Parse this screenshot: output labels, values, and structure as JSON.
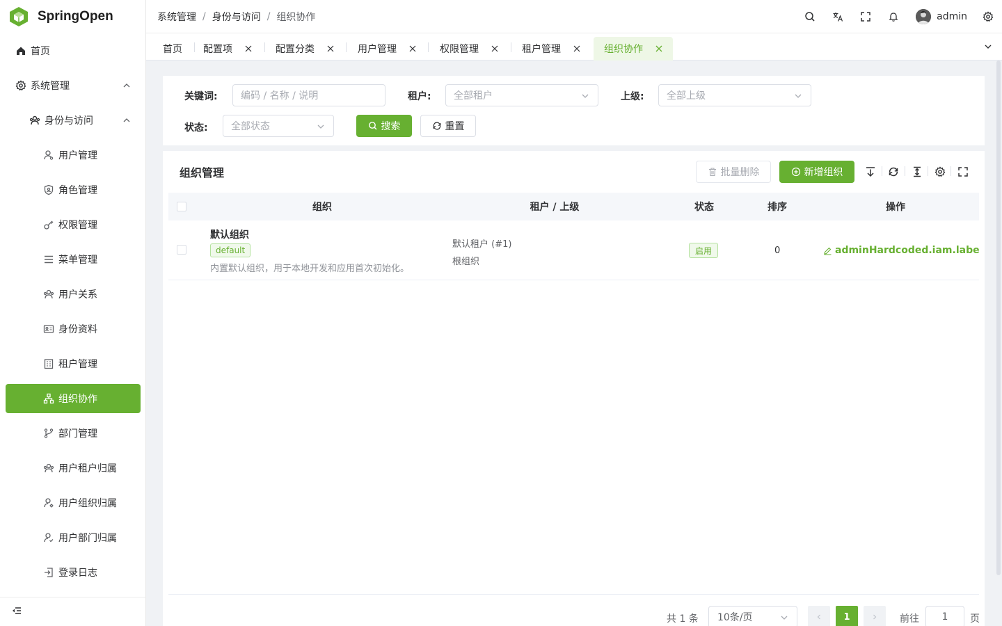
{
  "app": {
    "name": "SpringOpen",
    "accent": "#67b031"
  },
  "sidebar": {
    "items": [
      {
        "label": "首页",
        "icon": "home-icon"
      },
      {
        "label": "系统管理",
        "icon": "gear-icon"
      },
      {
        "label": "身份与访问",
        "icon": "users-icon"
      },
      {
        "label": "用户管理",
        "icon": "user-icon"
      },
      {
        "label": "角色管理",
        "icon": "shield-icon"
      },
      {
        "label": "权限管理",
        "icon": "key-icon"
      },
      {
        "label": "菜单管理",
        "icon": "menu-icon"
      },
      {
        "label": "用户关系",
        "icon": "users-icon"
      },
      {
        "label": "身份资料",
        "icon": "id-card-icon"
      },
      {
        "label": "租户管理",
        "icon": "building-icon"
      },
      {
        "label": "组织协作",
        "icon": "org-icon"
      },
      {
        "label": "部门管理",
        "icon": "branch-icon"
      },
      {
        "label": "用户租户归属",
        "icon": "users-icon"
      },
      {
        "label": "用户组织归属",
        "icon": "user-gear-icon"
      },
      {
        "label": "用户部门归属",
        "icon": "user-check-icon"
      },
      {
        "label": "登录日志",
        "icon": "login-icon"
      }
    ],
    "active": "组织协作"
  },
  "header": {
    "breadcrumb": [
      "系统管理",
      "身份与访问",
      "组织协作"
    ],
    "breadcrumb_sep": "/",
    "username": "admin"
  },
  "tabs": [
    {
      "label": "首页",
      "closable": false
    },
    {
      "label": "配置项",
      "closable": true
    },
    {
      "label": "配置分类",
      "closable": true
    },
    {
      "label": "用户管理",
      "closable": true
    },
    {
      "label": "权限管理",
      "closable": true
    },
    {
      "label": "租户管理",
      "closable": true
    },
    {
      "label": "组织协作",
      "closable": true,
      "active": true
    }
  ],
  "search": {
    "keyword_label": "关键词:",
    "keyword_placeholder": "编码 / 名称 / 说明",
    "tenant_label": "租户:",
    "tenant_placeholder": "全部租户",
    "parent_label": "上级:",
    "parent_placeholder": "全部上级",
    "status_label": "状态:",
    "status_placeholder": "全部状态",
    "search_button": "搜索",
    "reset_button": "重置"
  },
  "table": {
    "title": "组织管理",
    "batch_delete": "批量删除",
    "add_button": "新增组织",
    "columns": [
      "组织",
      "租户 / 上级",
      "状态",
      "排序",
      "操作"
    ],
    "rows": [
      {
        "name": "默认组织",
        "code": "default",
        "description": "内置默认组织，用于本地开发和应用首次初始化。",
        "tenant": "默认租户 (#1)",
        "parent": "根组织",
        "status": "启用",
        "sort": "0",
        "action": "adminHardcoded.iam.labelActio"
      }
    ]
  },
  "pagination": {
    "total": "共 1 条",
    "page_size": "10条/页",
    "current_page": "1",
    "goto_label": "前往",
    "goto_value": "1",
    "page_suffix": "页"
  }
}
